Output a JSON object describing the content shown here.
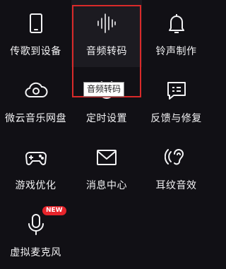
{
  "tools": [
    {
      "label": "传歌到设备",
      "icon": "phone-icon"
    },
    {
      "label": "音频转码",
      "icon": "audio-wave-icon"
    },
    {
      "label": "铃声制作",
      "icon": "bell-icon"
    },
    {
      "label": "微云音乐网盘",
      "icon": "cloud-icon"
    },
    {
      "label": "定时设置",
      "icon": "alarm-clock-icon"
    },
    {
      "label": "反馈与修复",
      "icon": "feedback-chat-icon"
    },
    {
      "label": "游戏优化",
      "icon": "gamepad-icon"
    },
    {
      "label": "消息中心",
      "icon": "envelope-icon"
    },
    {
      "label": "耳纹音效",
      "icon": "ear-print-icon"
    },
    {
      "label": "虚拟麦克风",
      "icon": "microphone-icon"
    }
  ],
  "tooltip_text": "音频转码",
  "new_badge": "NEW",
  "colors": {
    "background": "#111015",
    "accent": "#e6242b",
    "selection": "#d92a2a"
  }
}
